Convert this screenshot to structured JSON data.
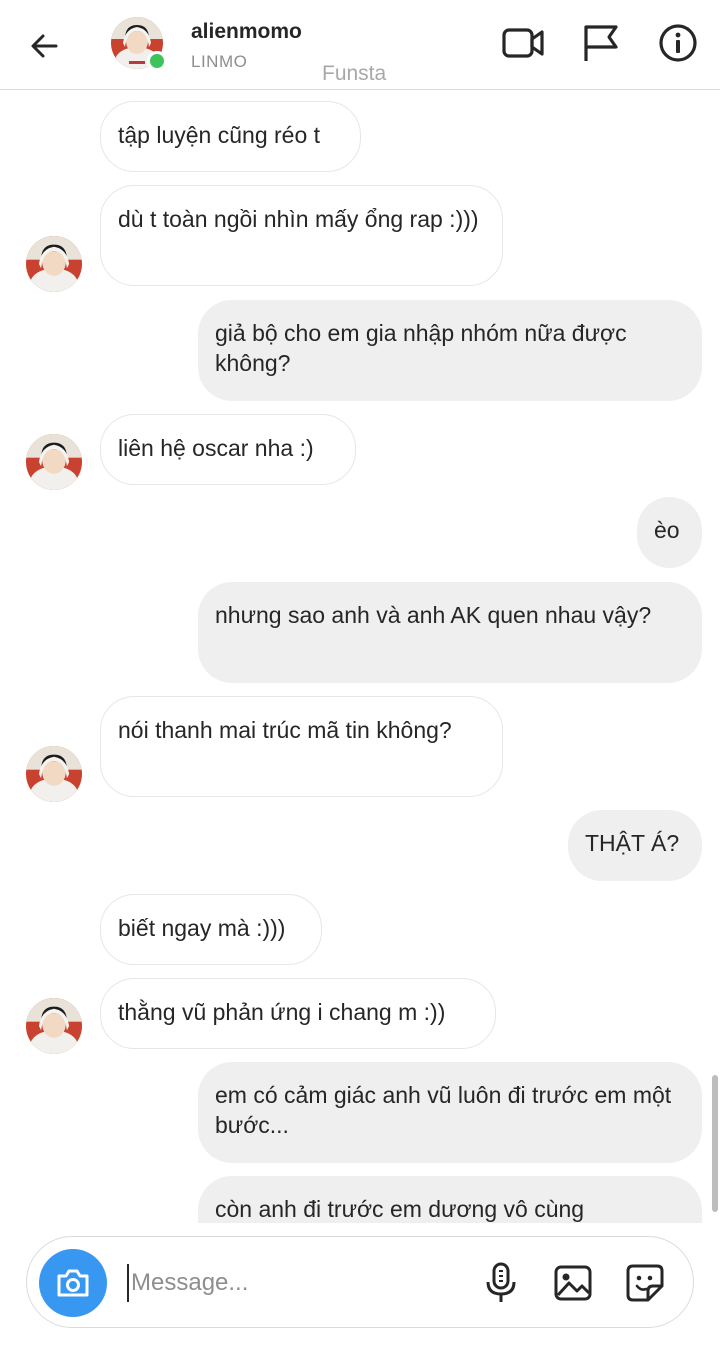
{
  "header": {
    "username": "alienmomo",
    "subname": "LINMO",
    "overlay_text": "Funsta",
    "icons": [
      "back-arrow-icon",
      "video-call-icon",
      "flag-icon",
      "info-icon"
    ],
    "online_color": "#3dc25c"
  },
  "messages": [
    {
      "side": "received",
      "text": "tập luyện cũng réo t"
    },
    {
      "side": "received",
      "text": "dù t toàn ngồi nhìn mấy ổng rap :)))"
    },
    {
      "side": "sent",
      "text": "giả bộ cho em gia nhập nhóm nữa được không?"
    },
    {
      "side": "received",
      "text": "liên hệ oscar nha :)"
    },
    {
      "side": "sent",
      "text": "èo"
    },
    {
      "side": "sent",
      "text": "nhưng sao anh và anh AK quen nhau vậy?"
    },
    {
      "side": "received",
      "text": "nói thanh mai trúc mã tin không?"
    },
    {
      "side": "sent",
      "text": "THẬT Á?"
    },
    {
      "side": "received",
      "text": "biết ngay mà :)))"
    },
    {
      "side": "received",
      "text": "thằng vũ phản ứng i chang m :))"
    },
    {
      "side": "sent",
      "text": "em có cảm giác anh vũ luôn đi trước em một bước..."
    },
    {
      "side": "sent",
      "text": "còn anh đi trước em dương vô cùng"
    }
  ],
  "composer": {
    "placeholder": "Message...",
    "value": "",
    "icons": [
      "camera-icon",
      "microphone-icon",
      "image-icon",
      "sticker-icon"
    ],
    "camera_color": "#3897f0"
  },
  "colors": {
    "sent_bubble": "#efefef",
    "received_border": "#e6e6e6",
    "text": "#262626",
    "muted": "#8e8e8e"
  }
}
